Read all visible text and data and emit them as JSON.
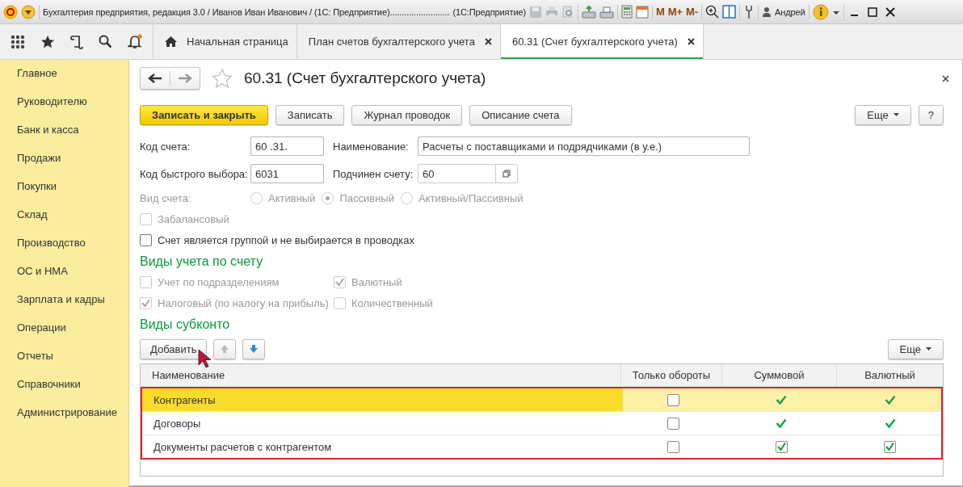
{
  "title_bar": {
    "title": "Бухгалтерия предприятия, редакция 3.0 / Иванов Иван Иванович / (1С: Предприятие).........................",
    "app": "(1С:Предприятие)",
    "memory": [
      "M",
      "M+",
      "M-"
    ],
    "user": "Андрей"
  },
  "tabs": [
    {
      "label": "Начальная страница",
      "kind": "home",
      "selected": false
    },
    {
      "label": "План счетов бухгалтерского учета",
      "kind": "closable",
      "selected": false
    },
    {
      "label": "60.31 (Счет бухгалтерского учета)",
      "kind": "closable",
      "selected": true
    }
  ],
  "sidebar": {
    "items": [
      "Главное",
      "Руководителю",
      "Банк и касса",
      "Продажи",
      "Покупки",
      "Склад",
      "Производство",
      "ОС и НМА",
      "Зарплата и кадры",
      "Операции",
      "Отчеты",
      "Справочники",
      "Администрирование"
    ]
  },
  "form": {
    "title": "60.31 (Счет бухгалтерского учета)",
    "forward_disabled": true,
    "buttons": [
      {
        "label": "Записать и закрыть",
        "kind": "primary"
      },
      {
        "label": "Записать",
        "kind": "default"
      },
      {
        "label": "Журнал проводок",
        "kind": "default"
      },
      {
        "label": "Описание счета",
        "kind": "default"
      }
    ],
    "more_button": "Еще",
    "help_button": "?",
    "field_rows": [
      [
        {
          "label": "Код счета:",
          "value": "60 .31.",
          "kind": "text"
        },
        {
          "label": "Наименование:",
          "value": "Расчеты с поставщиками и подрядчиками (в у.е.)",
          "kind": "wide"
        }
      ],
      [
        {
          "label": "Код быстрого выбора:",
          "value": "6031",
          "kind": "text"
        },
        {
          "label": "Подчинен счету:",
          "value": "60",
          "kind": "choice"
        }
      ]
    ],
    "account_type": {
      "label": "Вид счета:",
      "disabled": true,
      "options": [
        {
          "label": "Активный",
          "selected": false
        },
        {
          "label": "Пассивный",
          "selected": true
        },
        {
          "label": "Активный/Пассивный",
          "selected": false
        }
      ]
    },
    "checkboxes": [
      {
        "label": "Забалансовый",
        "checked": false,
        "disabled": true
      },
      {
        "label": "Счет является группой и не выбирается в проводках",
        "checked": false,
        "disabled": false
      }
    ],
    "accounting": {
      "title": "Виды учета по счету",
      "checkboxes": [
        {
          "label": "Учет по подразделениям",
          "checked": false,
          "disabled": true
        },
        {
          "label": "Валютный",
          "checked": true,
          "disabled": true
        },
        {
          "label": "Налоговый (по налогу на прибыль)",
          "checked": true,
          "disabled": true
        },
        {
          "label": "Количественный",
          "checked": false,
          "disabled": true
        }
      ]
    },
    "subconto": {
      "title": "Виды субконто",
      "add_button": "Добавить",
      "more_button": "Еще",
      "move_buttons": [
        {
          "kind": "up",
          "disabled": true
        },
        {
          "kind": "down",
          "disabled": false
        }
      ],
      "columns": [
        "Наименование",
        "Только обороты",
        "Суммовой",
        "Валютный"
      ],
      "rows": [
        {
          "name": "Контрагенты",
          "selected": true,
          "cells": [
            {
              "kind": "checkbox",
              "checked": false
            },
            {
              "kind": "tick",
              "checked": true
            },
            {
              "kind": "tick",
              "checked": true
            }
          ]
        },
        {
          "name": "Договоры",
          "selected": false,
          "cells": [
            {
              "kind": "checkbox",
              "checked": false
            },
            {
              "kind": "tick",
              "checked": true
            },
            {
              "kind": "tick",
              "checked": true
            }
          ]
        },
        {
          "name": "Документы расчетов с контрагентом",
          "selected": false,
          "cells": [
            {
              "kind": "checkbox",
              "checked": false
            },
            {
              "kind": "checkbox",
              "checked": true
            },
            {
              "kind": "checkbox",
              "checked": true
            }
          ]
        }
      ]
    }
  }
}
